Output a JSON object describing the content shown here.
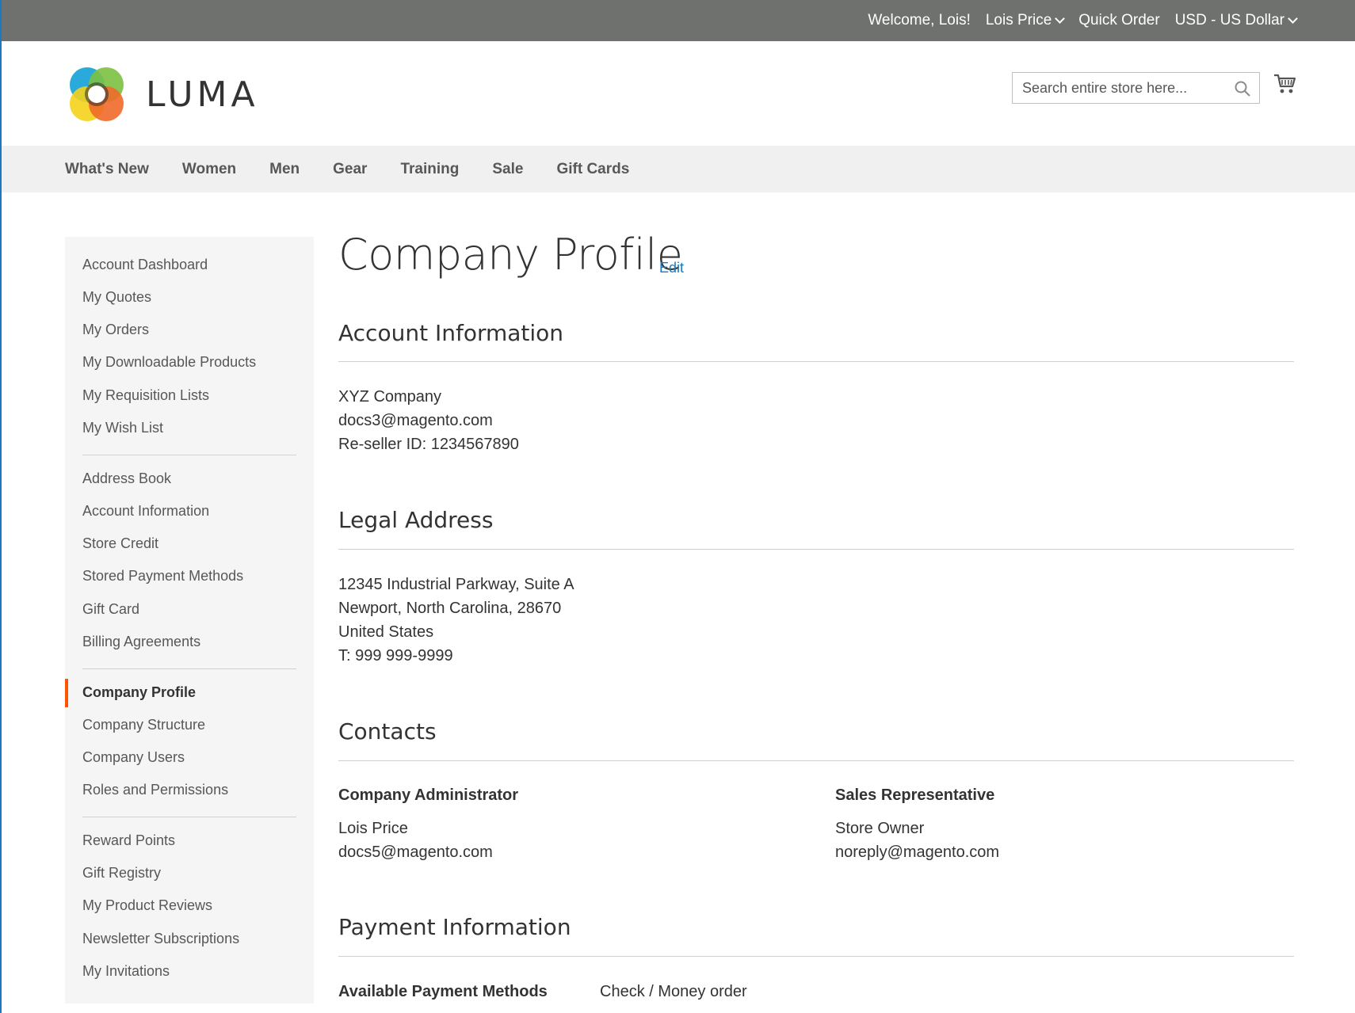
{
  "topbar": {
    "welcome": "Welcome, Lois!",
    "account_name": "Lois Price",
    "quick_order": "Quick Order",
    "currency": "USD - US Dollar"
  },
  "header": {
    "logo_text": "LUMA",
    "search_placeholder": "Search entire store here...",
    "icons": [
      "search-icon",
      "cart-icon"
    ]
  },
  "nav": {
    "items": [
      "What's New",
      "Women",
      "Men",
      "Gear",
      "Training",
      "Sale",
      "Gift Cards"
    ]
  },
  "sidebar": {
    "group1": [
      "Account Dashboard",
      "My Quotes",
      "My Orders",
      "My Downloadable Products",
      "My Requisition Lists",
      "My Wish List"
    ],
    "group2": [
      "Address Book",
      "Account Information",
      "Store Credit",
      "Stored Payment Methods",
      "Gift Card",
      "Billing Agreements"
    ],
    "group3": [
      "Company Profile",
      "Company Structure",
      "Company Users",
      "Roles and Permissions"
    ],
    "group4": [
      "Reward Points",
      "Gift Registry",
      "My Product Reviews",
      "Newsletter Subscriptions",
      "My Invitations"
    ],
    "active": "Company Profile"
  },
  "main": {
    "title": "Company Profile",
    "edit_label": "Edit",
    "account_info": {
      "heading": "Account Information",
      "company": "XYZ Company",
      "email": "docs3@magento.com",
      "reseller": "Re-seller ID: 1234567890"
    },
    "legal_address": {
      "heading": "Legal Address",
      "street": "12345 Industrial Parkway, Suite A",
      "city": "Newport, North Carolina, 28670",
      "country": "United States",
      "phone": "T: 999 999-9999"
    },
    "contacts": {
      "heading": "Contacts",
      "admin_label": "Company Administrator",
      "admin_name": "Lois Price",
      "admin_email": "docs5@magento.com",
      "rep_label": "Sales Representative",
      "rep_name": "Store Owner",
      "rep_email": "noreply@magento.com"
    },
    "payment": {
      "heading": "Payment Information",
      "methods_label": "Available Payment Methods",
      "methods_value": "Check / Money order"
    }
  },
  "colors": {
    "topbar_bg": "#6e716e",
    "nav_bg": "#f0f0f0",
    "sidebar_bg": "#f5f5f5",
    "link": "#1979c3",
    "active_marker": "#ff5501"
  }
}
